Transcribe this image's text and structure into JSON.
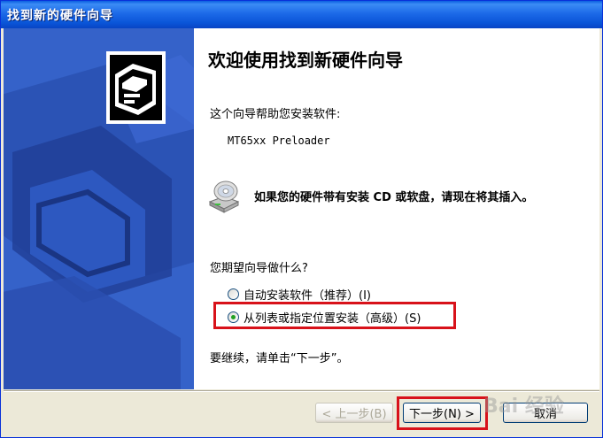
{
  "window": {
    "title": "找到新的硬件向导"
  },
  "main": {
    "heading": "欢迎使用找到新硬件向导",
    "intro": "这个向导帮助您安装软件:",
    "device_name": "MT65xx Preloader",
    "cd_prompt": "如果您的硬件带有安装 CD 或软盘，请现在将其插入。",
    "question": "您期望向导做什么?",
    "options": [
      {
        "label": "自动安装软件（推荐）(I)",
        "selected": false
      },
      {
        "label": "从列表或指定位置安装（高级）(S)",
        "selected": true
      }
    ],
    "continue_text": "要继续，请单击“下一步”。"
  },
  "buttons": {
    "back": "< 上一步(B)",
    "next": "下一步(N) >",
    "cancel": "取消"
  },
  "watermark": "Bai 经验",
  "colors": {
    "title_bar": "#0a55d8",
    "left_panel": "#3562c9",
    "highlight": "#d8121a"
  },
  "icons": [
    "hardware-box-icon",
    "cd-drive-icon"
  ]
}
